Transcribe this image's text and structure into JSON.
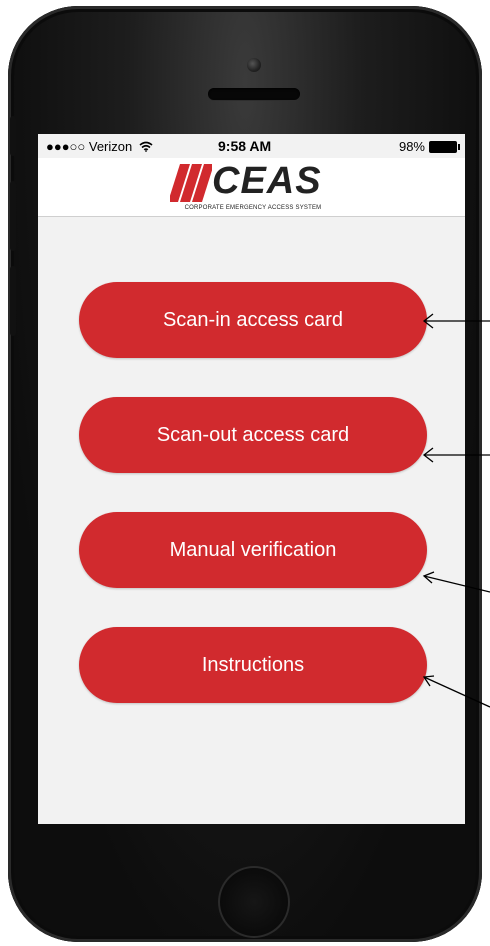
{
  "status_bar": {
    "carrier": "●●●○○ Verizon",
    "wifi_icon": "wifi-icon",
    "time": "9:58 AM",
    "battery": "98%"
  },
  "header": {
    "logo_text": "CEAS",
    "logo_tagline": "CORPORATE EMERGENCY ACCESS SYSTEM"
  },
  "menu": {
    "scan_in": "Scan-in access card",
    "scan_out": "Scan-out access card",
    "manual": "Manual verification",
    "instructions": "Instructions"
  },
  "colors": {
    "button": "#d12a2e",
    "screen_bg": "#f2f2f2",
    "logo_red": "#d12a2e"
  }
}
